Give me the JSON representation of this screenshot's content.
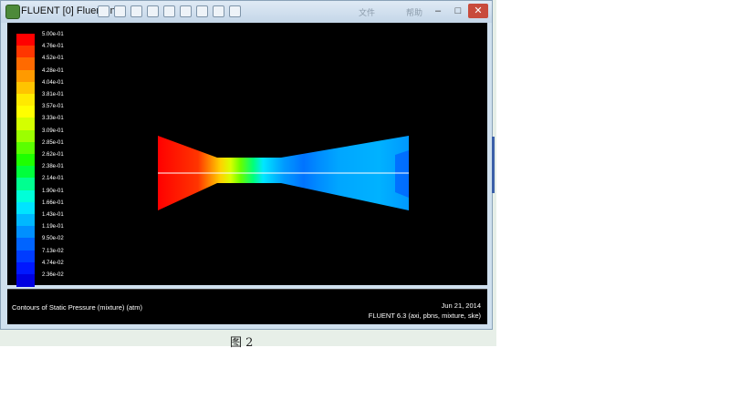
{
  "window": {
    "title": "FLUENT [0] Fluent Inc"
  },
  "toolbar": {
    "tools": [
      "print-icon",
      "settings-icon",
      "cursor-icon",
      "probe-icon",
      "layout-icon",
      "color-icon",
      "view-icon",
      "grid-icon",
      "draw-icon"
    ]
  },
  "title_controls": {
    "ghost_left": "文件",
    "ghost_right": "帮助"
  },
  "colorbar": {
    "labels": [
      "5.00e-01",
      "4.76e-01",
      "4.52e-01",
      "4.28e-01",
      "4.04e-01",
      "3.81e-01",
      "3.57e-01",
      "3.33e-01",
      "3.09e-01",
      "2.85e-01",
      "2.62e-01",
      "2.38e-01",
      "2.14e-01",
      "1.90e-01",
      "1.66e-01",
      "1.43e-01",
      "1.19e-01",
      "9.50e-02",
      "7.13e-02",
      "4.74e-02",
      "2.36e-02"
    ],
    "colors": [
      "#ff0000",
      "#ff3600",
      "#ff6a00",
      "#ff9a00",
      "#ffc400",
      "#ffea00",
      "#ffff00",
      "#d4ff00",
      "#9cff00",
      "#5aff00",
      "#1eff00",
      "#00ff3c",
      "#00ff90",
      "#00ffd8",
      "#00e4ff",
      "#00b8ff",
      "#0090ff",
      "#0064ff",
      "#003cff",
      "#0018ff",
      "#0000e0"
    ]
  },
  "caption": {
    "left": "Contours of Static Pressure (mixture)  (atm)",
    "date": "Jun 21, 2014",
    "version": "FLUENT 6.3 (axi, pbns, mixture, ske)"
  },
  "figure_caption": "图 2"
}
